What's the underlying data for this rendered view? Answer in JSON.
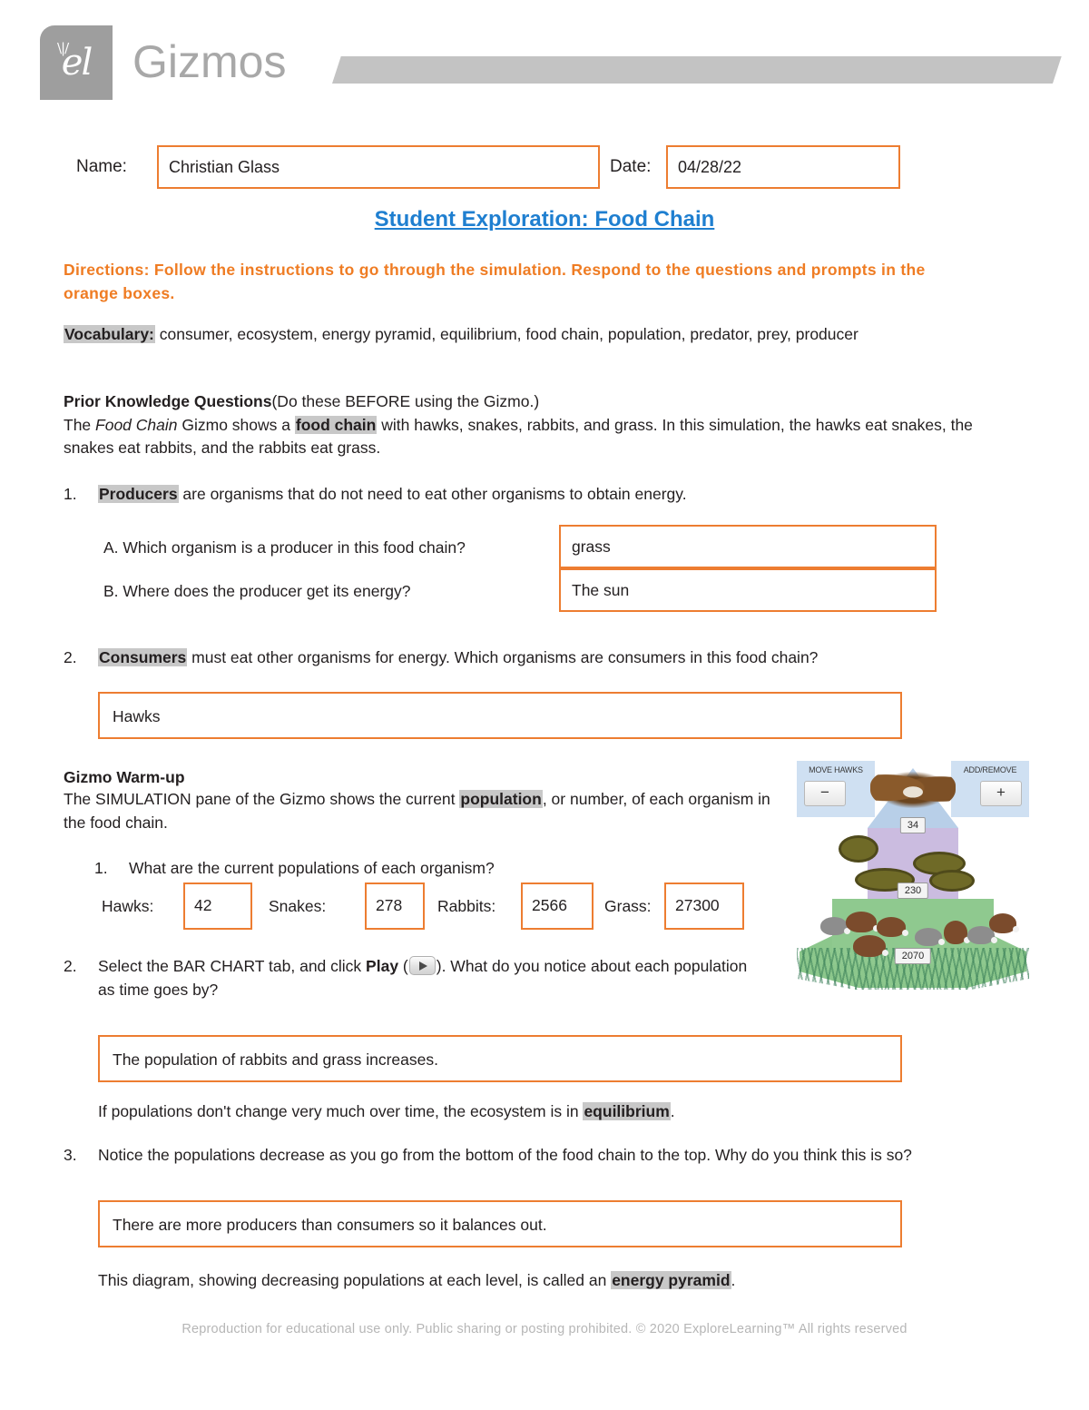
{
  "header": {
    "logo_mark": "el",
    "brand": "Gizmos"
  },
  "form": {
    "name_label": "Name:",
    "name_value": "Christian Glass",
    "date_label": "Date:",
    "date_value": "04/28/22"
  },
  "title": "Student Exploration: Food Chain",
  "directions": "Directions: Follow the instructions to go through the simulation. Respond to the questions and prompts in the orange boxes.",
  "vocabulary": {
    "label": "Vocabulary:",
    "terms": "consumer, ecosystem, energy pyramid, equilibrium, food chain, population, predator, prey, producer"
  },
  "prior_knowledge": {
    "heading": "Prior Knowledge Questions",
    "heading_note": "(Do these BEFORE using the Gizmo.)",
    "body_1": "The ",
    "body_italic": "Food Chain",
    "body_2": " Gizmo shows a ",
    "body_highlight": "food chain",
    "body_3": " with hawks, snakes, rabbits, and grass. In this simulation, the hawks eat snakes, the snakes eat rabbits, and the rabbits eat grass."
  },
  "q1": {
    "number": "1.",
    "term": "Producers",
    "text": " are organisms that do not need to eat other organisms to obtain energy.",
    "a_label": "A. Which organism is a producer in this food chain?",
    "a_answer": "grass",
    "b_label": "B. Where does the producer get its energy?",
    "b_answer": "The sun"
  },
  "q2": {
    "number": "2.",
    "term": "Consumers",
    "text": " must eat other organisms for energy. Which organisms are consumers in this food chain?",
    "answer": "Hawks"
  },
  "warmup": {
    "heading": "Gizmo Warm-up",
    "body_1": "The SIMULATION pane of the Gizmo shows the current ",
    "body_highlight": "population",
    "body_2": ", or number, of each organism in the food chain."
  },
  "wu1": {
    "number": "1.",
    "question": "What are the current populations of each organism?",
    "fields": [
      {
        "label": "Hawks:",
        "value": "42"
      },
      {
        "label": "Snakes:",
        "value": "278"
      },
      {
        "label": "Rabbits:",
        "value": "2566"
      },
      {
        "label": "Grass:",
        "value": "27300"
      }
    ]
  },
  "wu2": {
    "number": "2.",
    "text_1": "Select the BAR CHART tab, and click ",
    "bold": "Play",
    "text_2": " (",
    "icon": "play-icon",
    "text_3": "). What do you notice about each population as time goes by?",
    "answer": "The population of rabbits and grass increases."
  },
  "equilibrium_note": {
    "text_1": "If populations don't change very much over time, the ecosystem is in ",
    "highlight": "equilibrium",
    "text_2": "."
  },
  "wu3": {
    "number": "3.",
    "text": "Notice the populations decrease as you go from the bottom of the food chain to the top. Why do you think this is so?",
    "answer": "There are more producers than consumers so it balances out."
  },
  "pyramid_note": {
    "text_1": "This diagram, showing decreasing populations at each level, is called an ",
    "highlight": "energy pyramid",
    "text_2": "."
  },
  "footer": "Reproduction for educational use only. Public sharing or posting prohibited. © 2020 ExploreLearning™ All rights reserved",
  "simulation": {
    "left_panel_label": "MOVE HAWKS",
    "right_panel_label": "ADD/REMOVE",
    "minus_button": "−",
    "plus_button": "+",
    "hawk_count": "34",
    "snake_count": "230",
    "rabbit_count": "2070"
  },
  "colors": {
    "orange_border": "#ed7d31",
    "title_blue": "#1f7fd0",
    "directions_orange": "#ef7c23",
    "highlight_gray": "#c8c8c8",
    "brand_gray": "#9e9e9e",
    "footer_gray": "#b6b6b6"
  }
}
